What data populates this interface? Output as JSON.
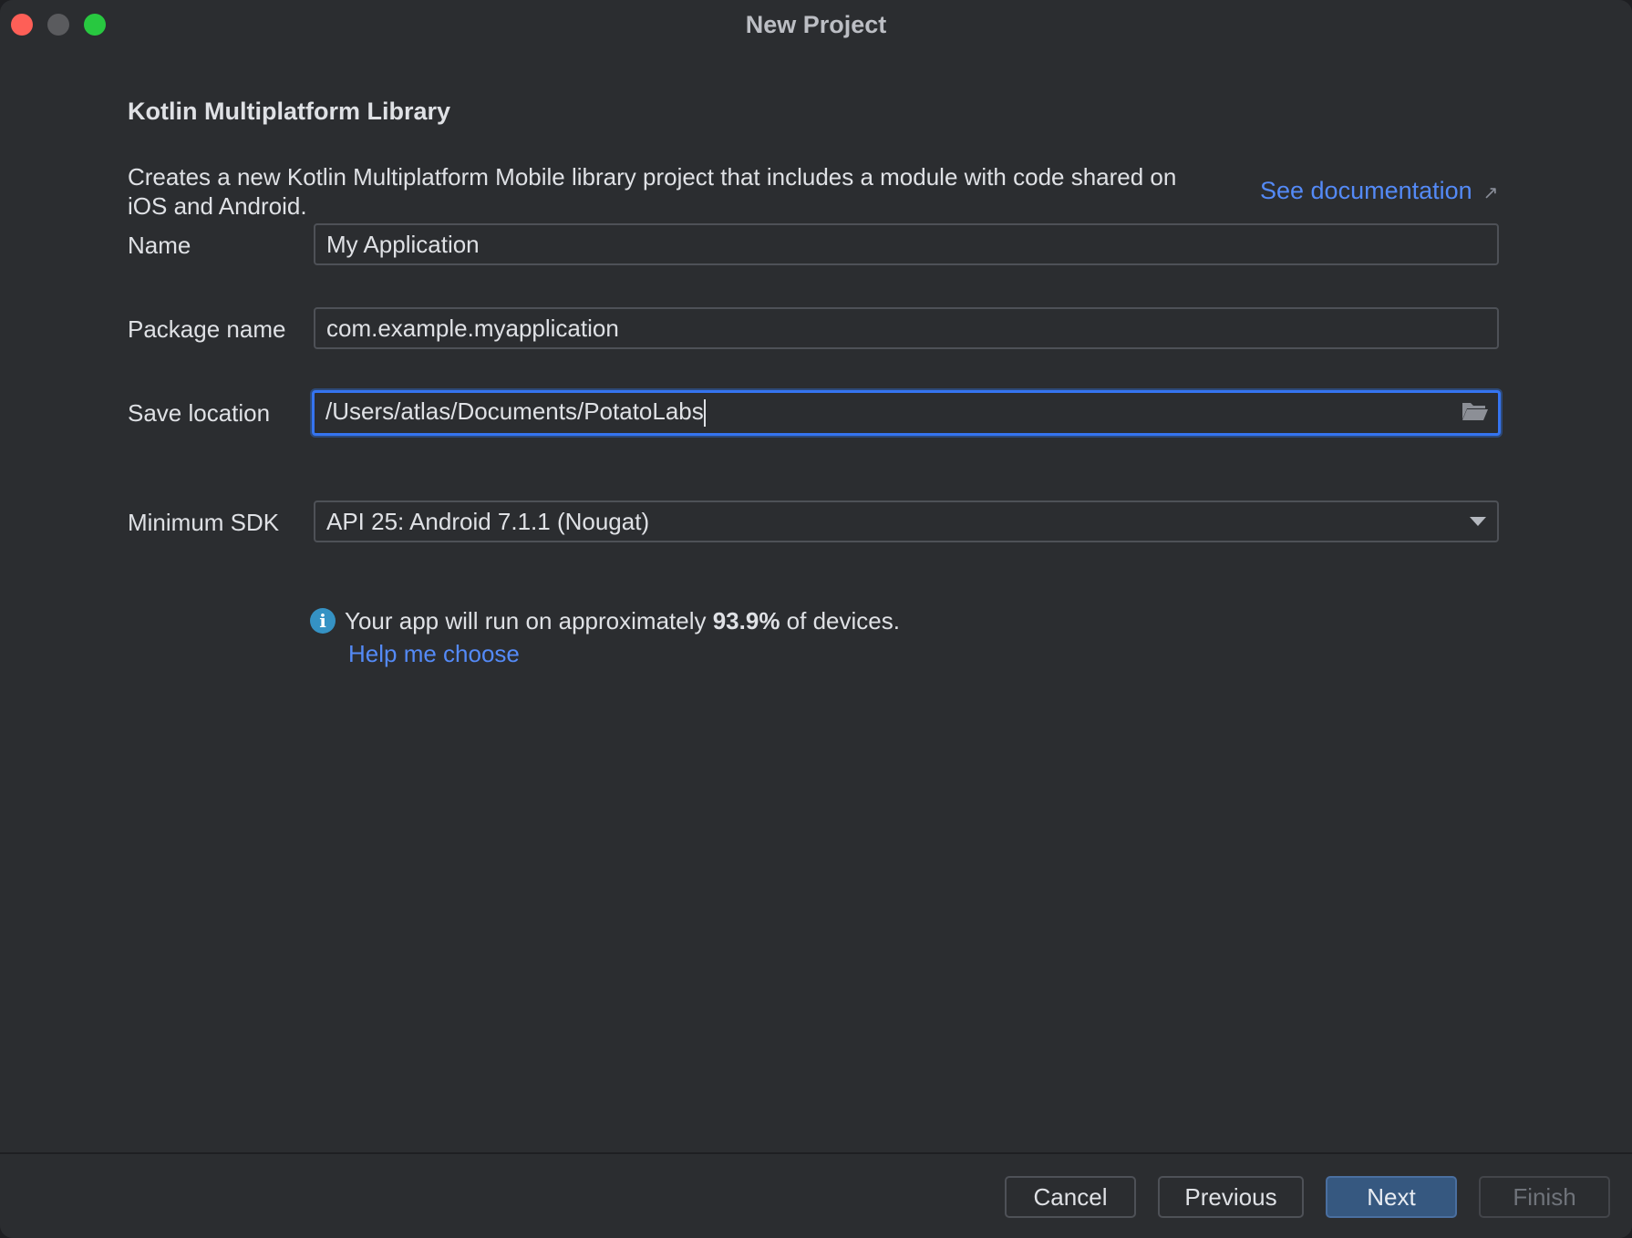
{
  "window": {
    "title": "New Project"
  },
  "wizard": {
    "heading": "Kotlin Multiplatform Library",
    "description": "Creates a new Kotlin Multiplatform Mobile library project that includes a module with code shared on iOS and Android.",
    "doc_link": "See documentation"
  },
  "form": {
    "name_label": "Name",
    "name_value": "My Application",
    "package_label": "Package name",
    "package_value": "com.example.myapplication",
    "location_label": "Save location",
    "location_value": "/Users/atlas/Documents/PotatoLabs",
    "sdk_label": "Minimum SDK",
    "sdk_value": "API 25: Android 7.1.1 (Nougat)"
  },
  "info": {
    "text_before": "Your app will run on approximately ",
    "percentage": "93.9%",
    "text_after": " of devices.",
    "help_link": "Help me choose"
  },
  "footer": {
    "cancel_label": "Cancel",
    "previous_label": "Previous",
    "next_label": "Next",
    "finish_label": "Finish"
  },
  "icons": {
    "info": "info-icon",
    "folder": "folder-icon",
    "external_link": "external-link-icon",
    "dropdown": "chevron-down-icon"
  },
  "colors": {
    "background": "#2b2d30",
    "link": "#548af7",
    "primary_button": "#365880",
    "focus_border": "#3574f0"
  }
}
